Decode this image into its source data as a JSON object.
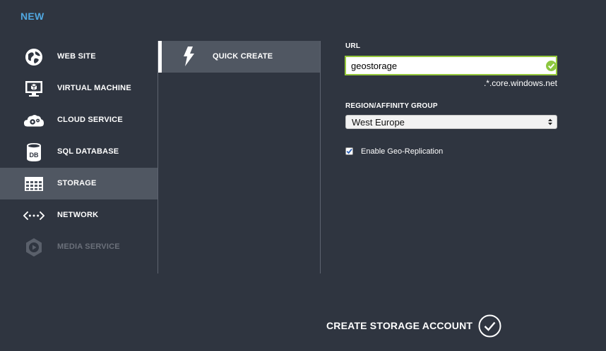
{
  "header": {
    "title": "NEW"
  },
  "nav": {
    "items": [
      {
        "label": "WEB SITE",
        "icon": "globe-icon",
        "selected": false,
        "disabled": false
      },
      {
        "label": "VIRTUAL MACHINE",
        "icon": "monitor-icon",
        "selected": false,
        "disabled": false
      },
      {
        "label": "CLOUD SERVICE",
        "icon": "cloud-gear-icon",
        "selected": false,
        "disabled": false
      },
      {
        "label": "SQL DATABASE",
        "icon": "database-icon",
        "selected": false,
        "disabled": false
      },
      {
        "label": "STORAGE",
        "icon": "table-icon",
        "selected": true,
        "disabled": false
      },
      {
        "label": "NETWORK",
        "icon": "network-icon",
        "selected": false,
        "disabled": false
      },
      {
        "label": "MEDIA SERVICE",
        "icon": "media-icon",
        "selected": false,
        "disabled": true
      }
    ]
  },
  "options": {
    "quick_create": {
      "label": "QUICK CREATE",
      "icon": "lightning-icon"
    }
  },
  "form": {
    "url_label": "URL",
    "url_value": "geostorage",
    "url_suffix": ".*.core.windows.net",
    "region_label": "REGION/AFFINITY GROUP",
    "region_selected": "West Europe",
    "geo_replication_label": "Enable Geo-Replication",
    "geo_replication_checked": true,
    "db_icon_text": "DB"
  },
  "footer": {
    "create_label": "CREATE STORAGE ACCOUNT"
  },
  "colors": {
    "background": "#2f3540",
    "accent_blue": "#50a7e0",
    "selected_bg": "#505762",
    "valid_green": "#8cc63f",
    "checkbox_blue": "#2b5fb4"
  }
}
